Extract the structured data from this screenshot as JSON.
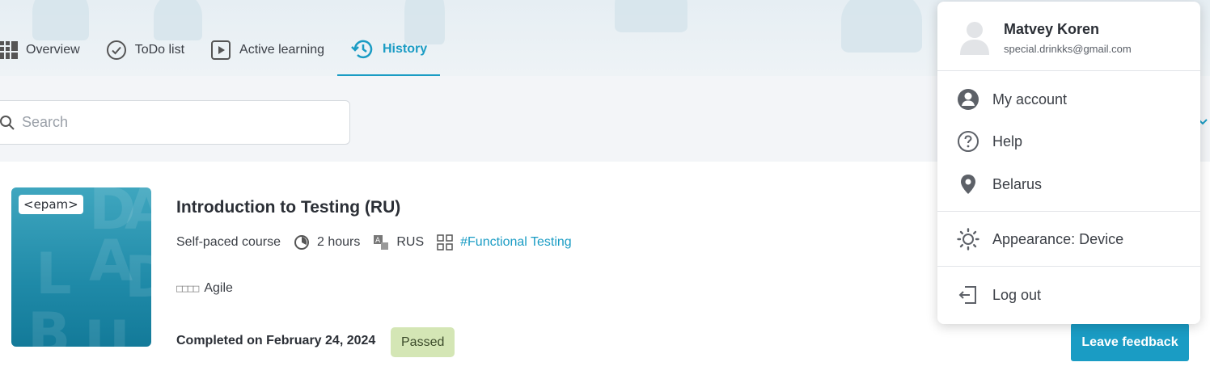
{
  "nav": {
    "tabs": [
      {
        "label": "Overview",
        "icon": "grid-icon"
      },
      {
        "label": "ToDo list",
        "icon": "check-circle-icon"
      },
      {
        "label": "Active learning",
        "icon": "play-square-icon"
      },
      {
        "label": "History",
        "icon": "history-icon",
        "active": true
      }
    ]
  },
  "search": {
    "placeholder": "Search",
    "value": ""
  },
  "course": {
    "logo": "<epam>",
    "title": "Introduction to Testing (RU)",
    "type": "Self-paced course",
    "duration": "2 hours",
    "language": "RUS",
    "tag": "#Functional Testing",
    "skill_boxes": "□□□□",
    "skill": "Agile",
    "completed": "Completed on February 24, 2024",
    "status": "Passed",
    "feedback_label": "Leave feedback"
  },
  "user_menu": {
    "name": "Matvey Koren",
    "email": "special.drinkks@gmail.com",
    "items": [
      {
        "label": "My account",
        "icon": "account-icon"
      },
      {
        "label": "Help",
        "icon": "help-icon"
      },
      {
        "label": "Belarus",
        "icon": "location-pin-icon"
      },
      {
        "label": "Appearance: Device",
        "icon": "sun-icon"
      },
      {
        "label": "Log out",
        "icon": "logout-icon"
      }
    ]
  },
  "colors": {
    "accent": "#1a9cc4",
    "badge_bg": "#d4e6b5",
    "background": "#f3f5f8"
  }
}
